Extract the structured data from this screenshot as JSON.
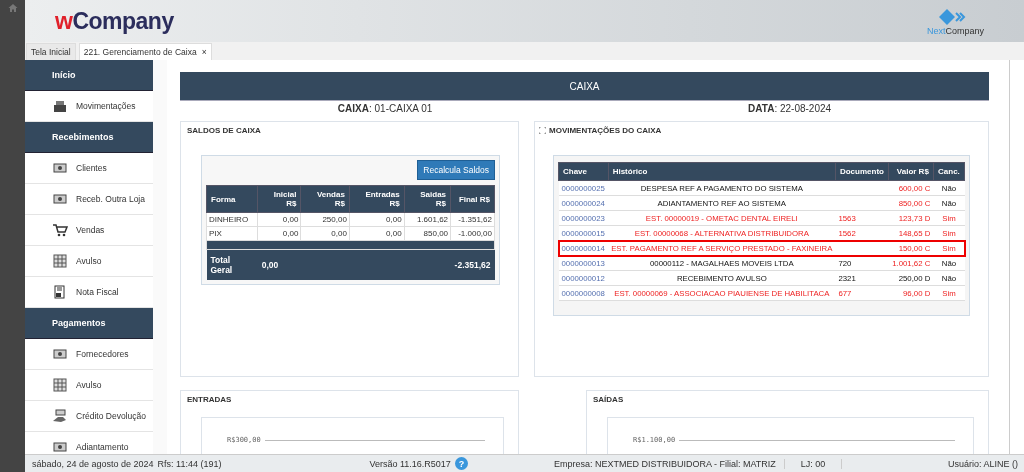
{
  "header": {
    "logo_accent": "w",
    "logo_text": "Company",
    "partner_logo_accent": "Next",
    "partner_logo_text": "Company"
  },
  "tabs": [
    {
      "label": "Tela Inicial",
      "selected": false
    },
    {
      "label": "221. Gerenciamento de Caixa",
      "selected": true,
      "close": "×"
    }
  ],
  "sidebar": {
    "sections": [
      {
        "title": "Início",
        "items": [
          {
            "label": "Movimentações"
          }
        ]
      },
      {
        "title": "Recebimentos",
        "items": [
          {
            "label": "Clientes"
          },
          {
            "label": "Receb. Outra Loja"
          },
          {
            "label": "Vendas"
          },
          {
            "label": "Avulso"
          },
          {
            "label": "Nota Fiscal"
          }
        ]
      },
      {
        "title": "Pagamentos",
        "items": [
          {
            "label": "Fornecedores"
          },
          {
            "label": "Avulso"
          },
          {
            "label": "Crédito Devolução"
          },
          {
            "label": "Adiantamento"
          }
        ]
      }
    ]
  },
  "caixa": {
    "title": "CAIXA",
    "caixa_label": "CAIXA",
    "caixa_value": ": 01-CAIXA 01",
    "data_label": "DATA",
    "data_value": ": 22-08-2024"
  },
  "saldos": {
    "title": "SALDOS DE CAIXA",
    "button": "Recalcula Saldos",
    "columns": [
      "Forma",
      "Inicial R$",
      "Vendas R$",
      "Entradas R$",
      "Saidas R$",
      "Final R$"
    ],
    "rows": [
      [
        "DINHEIRO",
        "0,00",
        "250,00",
        "0,00",
        "1.601,62",
        "-1.351,62"
      ],
      [
        "PIX",
        "0,00",
        "0,00",
        "0,00",
        "850,00",
        "-1.000,00"
      ]
    ],
    "total": {
      "label": "Total Geral",
      "inicial": "0,00",
      "final": "-2.351,62"
    }
  },
  "movimentacoes": {
    "title": "MOVIMENTAÇÕES DO CAIXA",
    "columns": [
      "Chave",
      "Histórico",
      "Documento",
      "Valor R$",
      "Canc."
    ],
    "rows": [
      {
        "chave": "0000000025",
        "historico": "DESPESA REF A PAGAMENTO DO SISTEMA",
        "documento": "",
        "valor": "600,00 C",
        "canc": "Não",
        "kind": "credit",
        "cancelled": false,
        "highlighted": false
      },
      {
        "chave": "0000000024",
        "historico": "ADIANTAMENTO REF AO SISTEMA",
        "documento": "",
        "valor": "850,00 C",
        "canc": "Não",
        "kind": "credit",
        "cancelled": false,
        "highlighted": false
      },
      {
        "chave": "0000000023",
        "historico": "EST. 00000019 - OMETAC DENTAL EIRELI",
        "documento": "1563",
        "valor": "123,73 D",
        "canc": "Sim",
        "cancelled": true,
        "highlighted": false
      },
      {
        "chave": "0000000015",
        "historico": "EST. 00000068 - ALTERNATIVA DISTRIBUIDORA",
        "documento": "1562",
        "valor": "148,65 D",
        "canc": "Sim",
        "cancelled": true,
        "highlighted": false
      },
      {
        "chave": "0000000014",
        "historico": "EST. PAGAMENTO REF A SERVIÇO PRESTADO - FAXINEIRA",
        "documento": "",
        "valor": "150,00 C",
        "canc": "Sim",
        "cancelled": true,
        "highlighted": true
      },
      {
        "chave": "0000000013",
        "historico": "00000112 - MAGALHAES MOVEIS LTDA",
        "documento": "720",
        "valor": "1.001,62 C",
        "canc": "Não",
        "kind": "credit",
        "cancelled": false,
        "highlighted": false
      },
      {
        "chave": "0000000012",
        "historico": "RECEBIMENTO AVULSO",
        "documento": "2321",
        "valor": "250,00 D",
        "canc": "Não",
        "kind": "debit",
        "cancelled": false,
        "highlighted": false
      },
      {
        "chave": "0000000008",
        "historico": "EST. 00000069 - ASSOCIACAO PIAUIENSE DE HABILITACA",
        "documento": "677",
        "valor": "96,00 D",
        "canc": "Sim",
        "cancelled": true,
        "highlighted": false
      }
    ]
  },
  "charts": [
    {
      "title": "ENTRADAS",
      "tick_label": "R$300,00"
    },
    {
      "title": "SAÍDAS",
      "tick_label": "R$1.100,00"
    }
  ],
  "status_bar": {
    "date": "sábado, 24 de agosto de 2024",
    "refresh": "Rfs: 11:44 (191)",
    "version": "Versão 11.16.R5017",
    "help": "?",
    "empresa": "Empresa: NEXTMED DISTRIBUIDORA - Filial: MATRIZ",
    "loja": "LJ: 00",
    "usuario": "Usuário: ALINE ()"
  }
}
